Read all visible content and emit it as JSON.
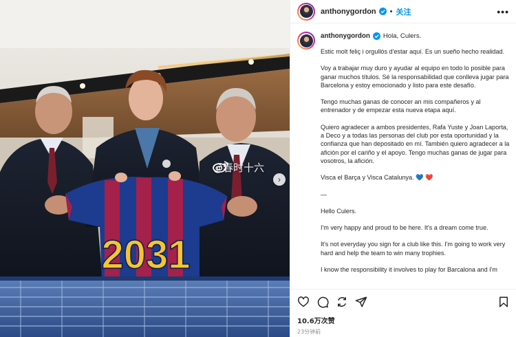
{
  "photo": {
    "shirt_number": "2031",
    "watermark_text": "@春时十六"
  },
  "header": {
    "username": "anthonygordon",
    "separator": "•",
    "follow_label": "关注",
    "more_label": "•••"
  },
  "caption": {
    "username": "anthonygordon",
    "greeting": "Hola, Culers.",
    "paragraphs": [
      "Estic molt feliç i orgullós d'estar aquí. Es un sueño hecho realidad.",
      "Voy a trabajar muy duro y ayudar al equipo en todo lo posible para ganar muchos títulos. Sé la responsabilidad que conlleva jugar para Barcelona y estoy emocionado y listo para este desafío.",
      "Tengo muchas ganas de conocer an mis compañeros y al entrenador y de empezar esta nueva etapa aquí.",
      "Quiero agradecer a ambos presidentes, Rafa Yuste y Joan Laporta, a Deco y a todas las personas del club por esta oportunidad y la confianza que han depositado en mí. También quiero agradecer a la afición por el cariño y el apoyo. Tengo muchas ganas de jugar para vosotros, la afición.",
      "Visca el Barça y Visca Catalunya. 💙 ❤️",
      "—",
      "Hello Culers.",
      "I'm very happy and proud to be here. It's a dream come true.",
      "It's not everyday you sign for a club like this. I'm going to work very hard and help the team to win many trophies.",
      "I know the responsibility it involves to play for Barcalona and I'm"
    ]
  },
  "engagement": {
    "likes": "10.6万次赞",
    "time_ago": "23分钟前"
  },
  "colors": {
    "follow_blue": "#0095f6",
    "barca_blue": "#1d3b8f",
    "barca_red": "#a3214a",
    "shirt_number_yellow": "#f4c431"
  },
  "icons": [
    "verified-badge-icon",
    "more-options-icon",
    "heart-icon",
    "comment-icon",
    "share-icon",
    "send-icon",
    "bookmark-icon",
    "chevron-right-icon",
    "weibo-icon"
  ]
}
